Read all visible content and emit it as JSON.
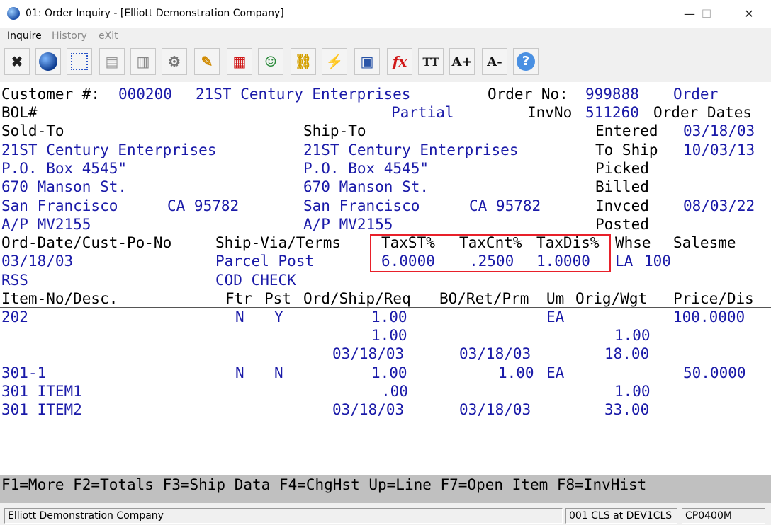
{
  "window": {
    "title": "01: Order Inquiry - [Elliott Demonstration Company]",
    "minimize": "—",
    "maximize": "☐",
    "close": "✕"
  },
  "menu": {
    "inquire": "Inquire",
    "history": "History",
    "exit": "eXit"
  },
  "toolbar": {
    "icons": [
      "close-icon",
      "globe-icon",
      "select-icon",
      "copy-icon",
      "paste-icon",
      "settings-icon",
      "edit-icon",
      "calendar-icon",
      "users-icon",
      "link-icon",
      "lightning-icon",
      "screen-icon",
      "function-icon",
      "text-size-icon",
      "font-increase-icon",
      "font-decrease-icon",
      "help-icon"
    ],
    "glyphs": [
      "✖",
      "●",
      "⬚",
      "▤",
      "▥",
      "⚙",
      "✎",
      "▦",
      "☺",
      "⛓",
      "⚡",
      "▣",
      "fx",
      "TT",
      "A+",
      "A-",
      "?"
    ]
  },
  "header": {
    "customer_label": "Customer #:",
    "customer_no": "000200",
    "customer_name": "21ST Century Enterprises",
    "order_no_label": "Order No:",
    "order_no": "999888",
    "order_word": "Order",
    "bol_label": "BOL#",
    "partial": "Partial",
    "invno_label": "InvNo",
    "invno": "511260",
    "order_dates_label": "Order Dates"
  },
  "sold_to": {
    "label": "Sold-To",
    "name": "21ST Century Enterprises",
    "addr1": "P.O. Box 4545\"",
    "addr2": "670 Manson St.",
    "city": "San Francisco",
    "state_zip": "CA 95782",
    "attn": "A/P MV2155"
  },
  "ship_to": {
    "label": "Ship-To",
    "name": "21ST Century Enterprises",
    "addr1": "P.O. Box 4545\"",
    "addr2": "670 Manson St.",
    "city": "San Francisco",
    "state_zip": "CA 95782",
    "attn": "A/P MV2155"
  },
  "dates": {
    "entered_label": "Entered",
    "entered": "03/18/03",
    "to_ship_label": "To Ship",
    "to_ship": "10/03/13",
    "picked_label": "Picked",
    "billed_label": "Billed",
    "invced_label": "Invced",
    "invced": "08/03/22",
    "posted_label": "Posted"
  },
  "terms": {
    "ord_date_label": "Ord-Date/Cust-Po-No",
    "ship_via_label": "Ship-Via/Terms",
    "taxst_label": "TaxST%",
    "taxcnt_label": "TaxCnt%",
    "taxdis_label": "TaxDis%",
    "whse_label": "Whse",
    "salesm_label": "Salesme",
    "ord_date": "03/18/03",
    "ship_via": "Parcel Post",
    "taxst": "6.0000",
    "taxcnt": ".2500",
    "taxdis": "1.0000",
    "whse": "LA",
    "salesman": "100",
    "cust_po": "RSS",
    "terms": "COD CHECK"
  },
  "lines": {
    "headers": {
      "item": "Item-No/Desc.",
      "ftr": "Ftr",
      "pst": "Pst",
      "ord_ship_req": "Ord/Ship/Req",
      "bo_ret_prm": "BO/Ret/Prm",
      "um": "Um",
      "orig_wgt": "Orig/Wgt",
      "price_dis": "Price/Dis"
    },
    "l1": {
      "item": "202",
      "ftr": "N",
      "pst": "Y",
      "ord": "1.00",
      "um": "EA",
      "price": "100.0000",
      "ship": "1.00",
      "orig": "1.00",
      "req": "03/18/03",
      "prm": "03/18/03",
      "wgt": "18.00"
    },
    "l2": {
      "item": "301-1",
      "ftr": "N",
      "pst": "N",
      "ord": "1.00",
      "bo": "1.00",
      "um": "EA",
      "price": "50.0000",
      "desc1": "301 ITEM1",
      "ship": ".00",
      "orig": "1.00",
      "desc2": "301 ITEM2",
      "req": "03/18/03",
      "prm": "03/18/03",
      "wgt": "33.00"
    }
  },
  "fkeys": "F1=More F2=Totals F3=Ship Data F4=ChgHst Up=Line F7=Open Item F8=InvHist",
  "status": {
    "company": "Elliott Demonstration Company",
    "session": "001 CLS at DEV1CLS",
    "program": "CP0400M"
  }
}
